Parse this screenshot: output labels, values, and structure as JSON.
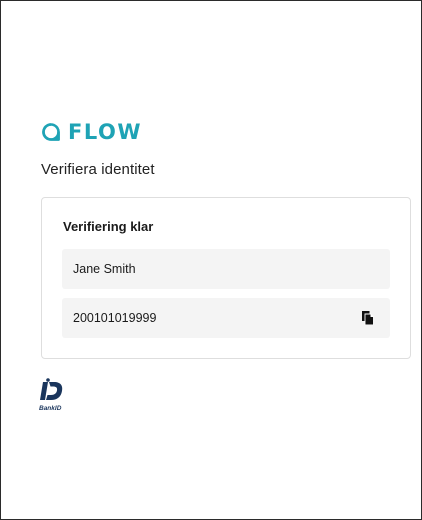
{
  "brand": {
    "name": "FLOW",
    "color": "#1fa3b5"
  },
  "page": {
    "subtitle": "Verifiera identitet"
  },
  "card": {
    "title": "Verifiering klar",
    "name_value": "Jane Smith",
    "personal_number": "200101019999",
    "copy_icon": "copy-icon"
  },
  "footer": {
    "bankid_label": "BankID",
    "bankid_color": "#1b365d"
  }
}
